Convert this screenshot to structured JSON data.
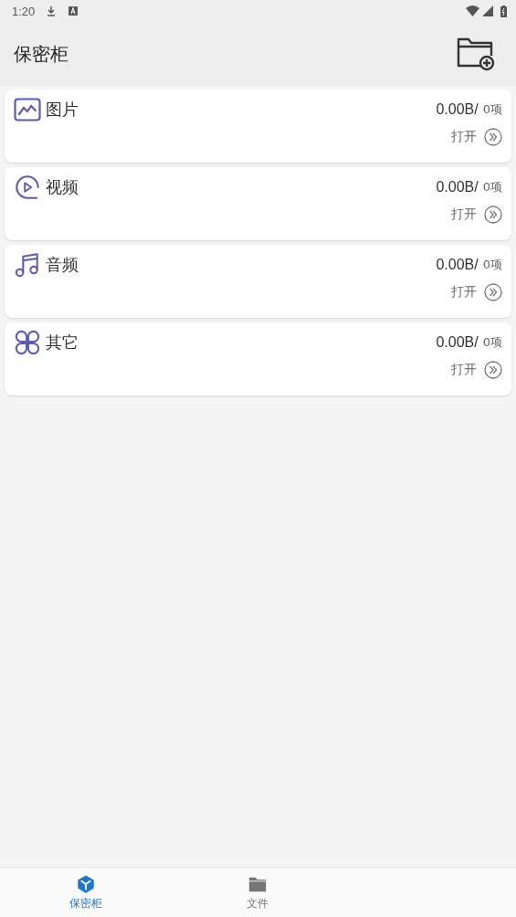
{
  "status_bar": {
    "time": "1:20"
  },
  "app_bar": {
    "title": "保密柜"
  },
  "categories": [
    {
      "kind": "image",
      "name": "图片",
      "size": "0.00B/",
      "count": "0项",
      "action": "打开"
    },
    {
      "kind": "video",
      "name": "视频",
      "size": "0.00B/",
      "count": "0项",
      "action": "打开"
    },
    {
      "kind": "audio",
      "name": "音频",
      "size": "0.00B/",
      "count": "0项",
      "action": "打开"
    },
    {
      "kind": "other",
      "name": "其它",
      "size": "0.00B/",
      "count": "0项",
      "action": "打开"
    }
  ],
  "bottom_nav": [
    {
      "kind": "vault",
      "label": "保密柜",
      "selected": true
    },
    {
      "kind": "files",
      "label": "文件",
      "selected": false
    }
  ]
}
